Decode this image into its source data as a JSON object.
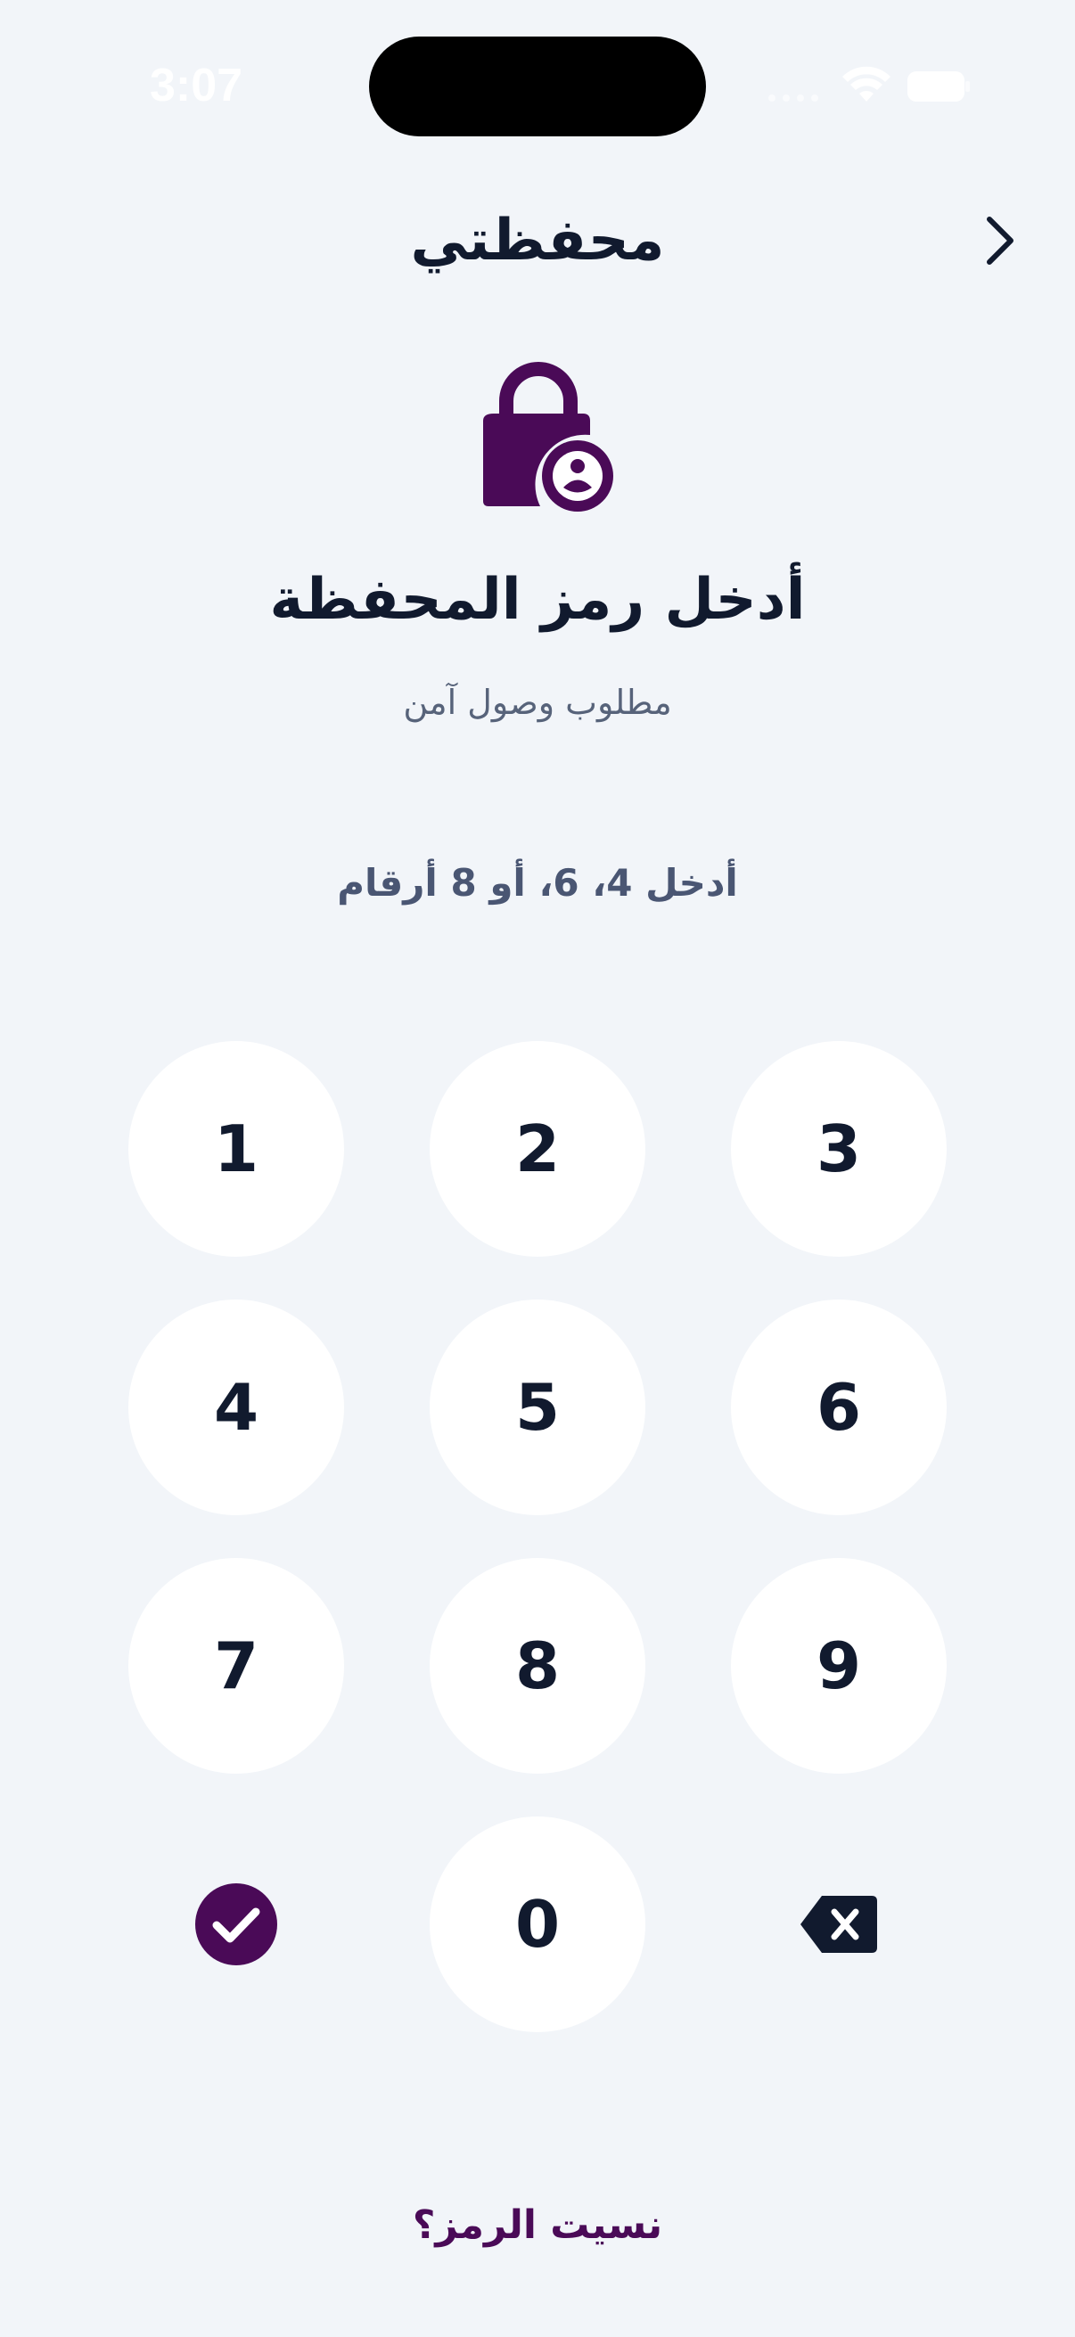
{
  "status_bar": {
    "time": "3:07"
  },
  "header": {
    "title": "محفظتي",
    "back_icon": "chevron-right-icon"
  },
  "lock": {
    "icon": "lock-user-icon",
    "color": "#4a0a57"
  },
  "main": {
    "title": "أدخل رمز المحفظة",
    "subtitle": "مطلوب وصول آمن",
    "hint": "أدخل 4، 6، أو 8 أرقام"
  },
  "keypad": {
    "keys": [
      "1",
      "2",
      "3",
      "4",
      "5",
      "6",
      "7",
      "8",
      "9",
      "0"
    ],
    "confirm_icon": "check-circle-icon",
    "delete_icon": "backspace-icon"
  },
  "footer": {
    "forgot_label": "نسيت الرمز؟"
  },
  "colors": {
    "background": "#f2f5f9",
    "accent": "#4a0a57",
    "text": "#111a2e"
  }
}
